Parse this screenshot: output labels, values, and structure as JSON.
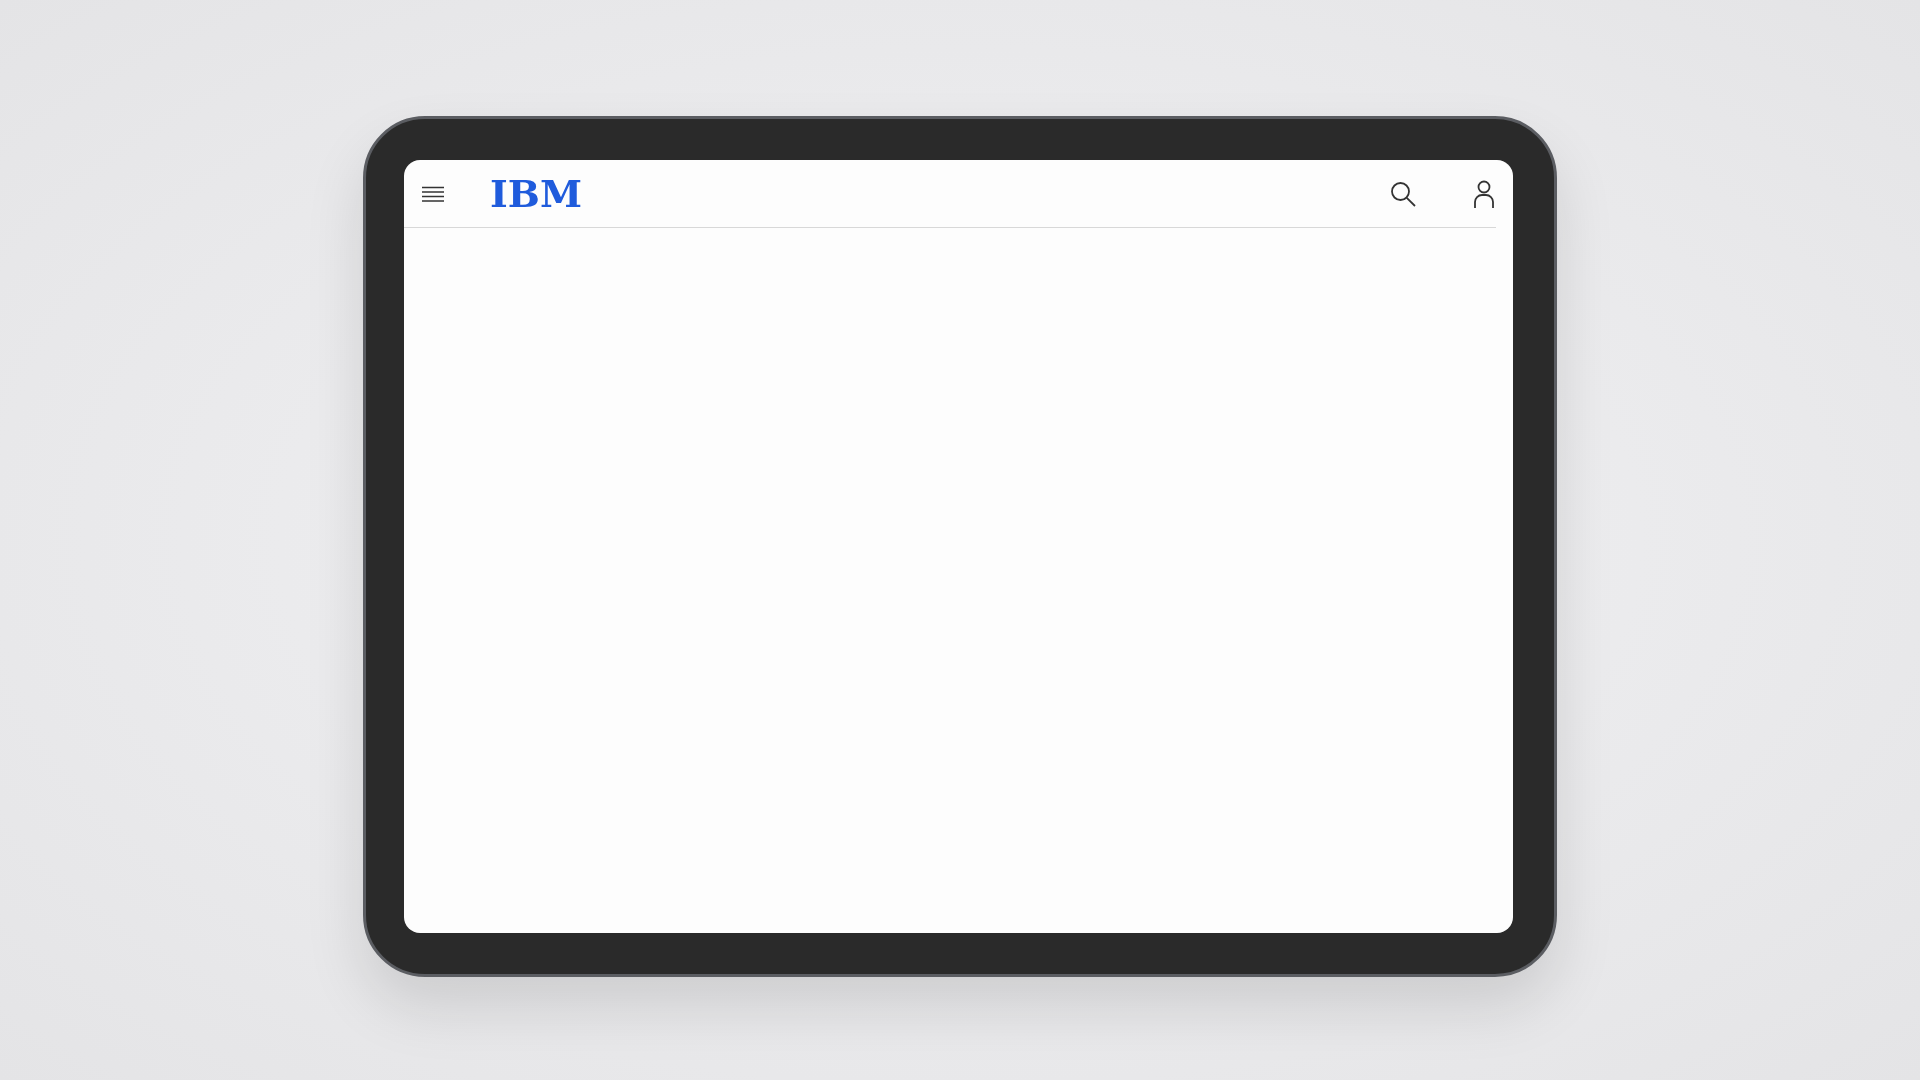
{
  "header": {
    "logo": "IBM"
  }
}
